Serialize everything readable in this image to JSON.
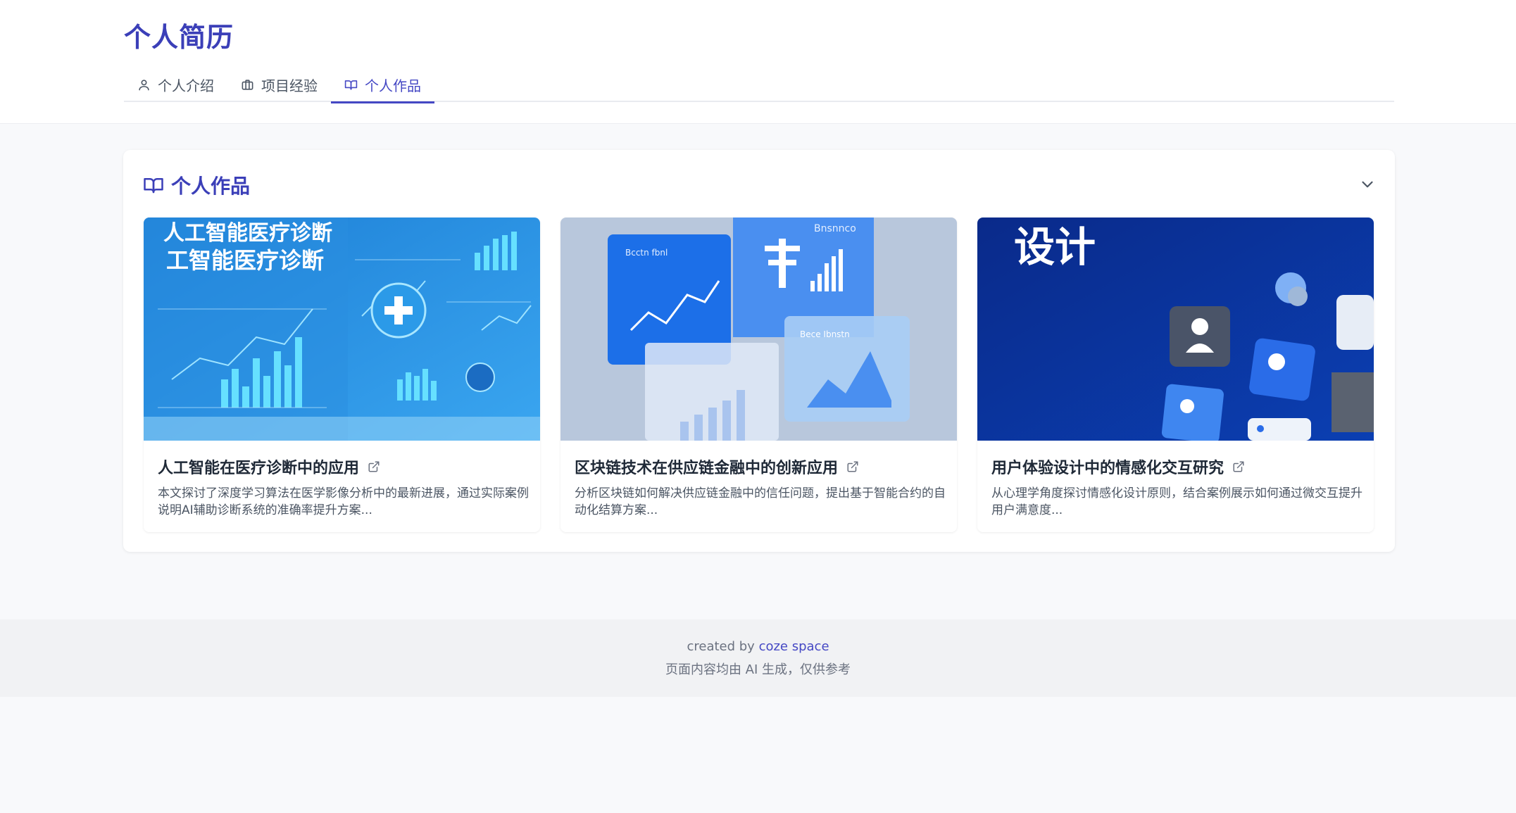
{
  "header": {
    "title": "个人简历",
    "tabs": [
      {
        "label": "个人介绍",
        "icon": "user-icon",
        "active": false
      },
      {
        "label": "项目经验",
        "icon": "briefcase-icon",
        "active": false
      },
      {
        "label": "个人作品",
        "icon": "book-icon",
        "active": true
      }
    ]
  },
  "section": {
    "title": "个人作品",
    "icon": "book-icon",
    "collapse_icon": "chevron-down-icon"
  },
  "works": [
    {
      "title": "人工智能在医疗诊断中的应用",
      "description": "本文探讨了深度学习算法在医学影像分析中的最新进展，通过实际案例说明AI辅助诊断系统的准确率提升方案...",
      "image_text_line1": "人工智能医疗诊断",
      "image_text_line2": "工智能医疗诊断"
    },
    {
      "title": "区块链技术在供应链金融中的创新应用",
      "description": "分析区块链如何解决供应链金融中的信任问题，提出基于智能合约的自动化结算方案...",
      "image_text_line1": "Bnsnnco",
      "image_text_line2": "Bcctn fbnl",
      "image_text_line3": "Bece Ibnstn"
    },
    {
      "title": "用户体验设计中的情感化交互研究",
      "description": "从心理学角度探讨情感化设计原则，结合案例展示如何通过微交互提升用户满意度...",
      "image_text_line1": "设计"
    }
  ],
  "footer": {
    "created_prefix": "created by ",
    "created_link": "coze space",
    "disclaimer": "页面内容均由 AI 生成，仅供参考"
  },
  "colors": {
    "accent": "#4548c4",
    "title": "#3b3fb8",
    "background": "#f8f9fb"
  }
}
